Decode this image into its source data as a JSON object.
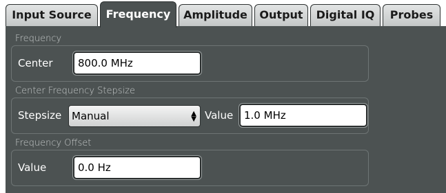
{
  "tabs": [
    {
      "label": "Input Source",
      "active": false
    },
    {
      "label": "Frequency",
      "active": true
    },
    {
      "label": "Amplitude",
      "active": false
    },
    {
      "label": "Output",
      "active": false
    },
    {
      "label": "Digital IQ",
      "active": false
    },
    {
      "label": "Probes",
      "active": false
    }
  ],
  "frequency_group": {
    "title": "Frequency",
    "center_label": "Center",
    "center_value": "800.0 MHz"
  },
  "stepsize_group": {
    "title": "Center Frequency Stepsize",
    "stepsize_label": "Stepsize",
    "stepsize_selected": "Manual",
    "value_label": "Value",
    "value": "1.0 MHz"
  },
  "offset_group": {
    "title": "Frequency Offset",
    "value_label": "Value",
    "value": "0.0 Hz"
  },
  "colors": {
    "panel_bg": "#4c5252",
    "tab_inactive": "#d3d5d5",
    "label_text": "#ffffff",
    "group_title_text": "#c8cccc"
  }
}
